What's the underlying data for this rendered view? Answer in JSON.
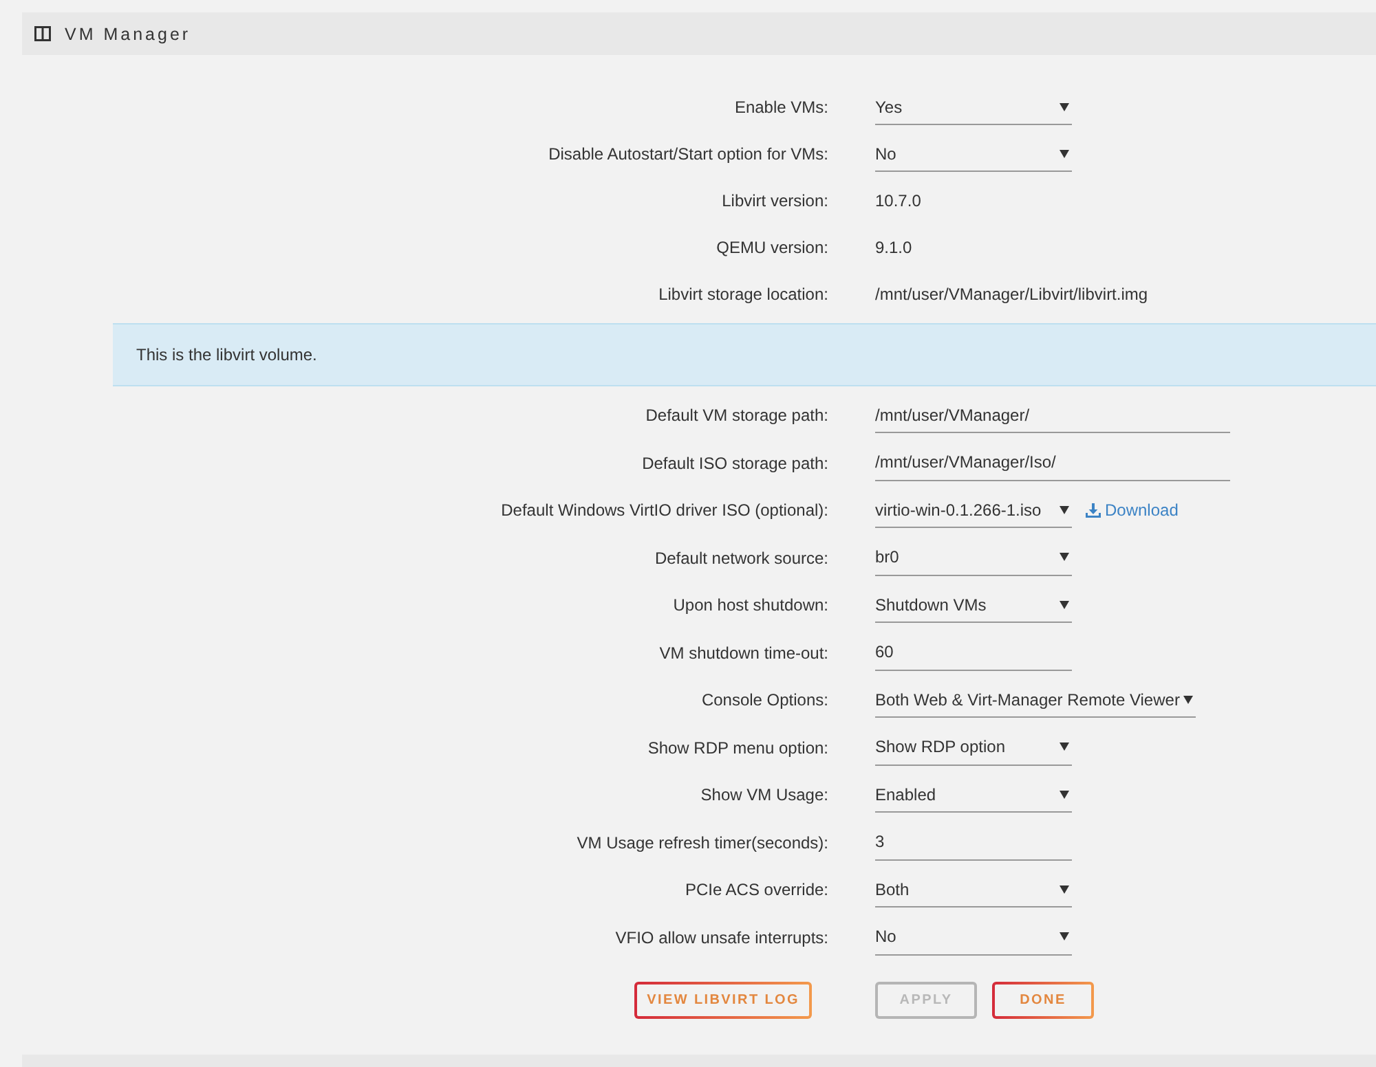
{
  "panel": {
    "title": "VM Manager"
  },
  "settings": [
    {
      "kind": "select",
      "label": "Enable VMs:",
      "value": "Yes"
    },
    {
      "kind": "select",
      "label": "Disable Autostart/Start option for VMs:",
      "value": "No"
    },
    {
      "kind": "readout",
      "label": "Libvirt version:",
      "value": "10.7.0"
    },
    {
      "kind": "readout",
      "label": "QEMU version:",
      "value": "9.1.0"
    },
    {
      "kind": "readout",
      "label": "Libvirt storage location:",
      "value": "/mnt/user/VManager/Libvirt/libvirt.img"
    }
  ],
  "note": "This is the libvirt volume.",
  "settings_2": [
    {
      "kind": "path",
      "label": "Default VM storage path:",
      "value": "/mnt/user/VManager/"
    },
    {
      "kind": "path",
      "label": "Default ISO storage path:",
      "value": "/mnt/user/VManager/Iso/"
    },
    {
      "kind": "select",
      "label": "Default Windows VirtIO driver ISO (optional):",
      "value": "virtio-win-0.1.266-1.iso",
      "link": "Download"
    },
    {
      "kind": "select",
      "label": "Default network source:",
      "value": "br0"
    },
    {
      "kind": "select",
      "label": "Upon host shutdown:",
      "value": "Shutdown VMs"
    },
    {
      "kind": "number",
      "label": "VM shutdown time-out:",
      "value": "60"
    },
    {
      "kind": "select",
      "label": "Console Options:",
      "value": "Both Web & Virt-Manager Remote Viewer"
    },
    {
      "kind": "select",
      "label": "Show RDP menu option:",
      "value": "Show RDP option"
    },
    {
      "kind": "select",
      "label": "Show VM Usage:",
      "value": "Enabled"
    },
    {
      "kind": "number",
      "label": "VM Usage refresh timer(seconds):",
      "value": "3"
    },
    {
      "kind": "select",
      "label": "PCIe ACS override:",
      "value": "Both"
    },
    {
      "kind": "select",
      "label": "VFIO allow unsafe interrupts:",
      "value": "No"
    }
  ],
  "buttons": [
    {
      "label": "VIEW LIBVIRT LOG",
      "disabled": false
    },
    {
      "label": "APPLY",
      "disabled": true
    },
    {
      "label": "DONE",
      "disabled": false
    }
  ]
}
